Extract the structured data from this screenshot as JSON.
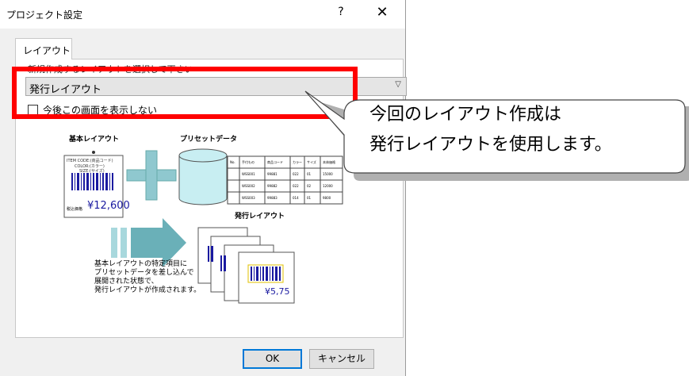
{
  "window": {
    "title": "プロジェクト設定",
    "help_glyph": "?",
    "close_glyph": "✕"
  },
  "tabs": [
    {
      "label": "レイアウト"
    }
  ],
  "form": {
    "instruction": "新規作成するレイアウトを選択して下さい",
    "layout_select": {
      "value": "発行レイアウト",
      "arrow_icon": "chevron-down-icon"
    },
    "dont_show_checkbox": {
      "label": "今後この画面を表示しない",
      "checked": false
    }
  },
  "illustration": {
    "base_layout_label": "基本レイアウト",
    "preset_data_label": "プリセットデータ",
    "issued_layout_label": "発行レイアウト",
    "tag": {
      "item_code": "ITEM CODE:(商品コード)",
      "color": "COLOR:(カラー)",
      "size": "SIZE:(サイズ)",
      "price_prefix": "税込価格",
      "price": "¥12,600"
    },
    "issued_tag_price": "¥5,75",
    "table": {
      "headers": [
        "No.",
        "手付もの",
        "商品コード",
        "カラー",
        "サイズ",
        "本体価格"
      ],
      "rows": [
        [
          "",
          "WSS001",
          "99881",
          "022",
          "01",
          "15000"
        ],
        [
          "",
          "WSS002",
          "99882",
          "022",
          "02",
          "12000"
        ],
        [
          "",
          "WSS003",
          "99883",
          "014",
          "01",
          "9800"
        ]
      ]
    },
    "description": [
      "基本レイアウトの特定項目に",
      "プリセットデータを差し込んで",
      "展開された状態で、",
      "発行レイアウトが作成されます。"
    ]
  },
  "buttons": {
    "ok": "OK",
    "cancel": "キャンセル"
  },
  "callout": {
    "line1": "今回のレイアウト作成は",
    "line2": "発行レイアウトを使用します。"
  },
  "colors": {
    "highlight": "#ff0000",
    "accent": "#0078d7",
    "arrow": "#5aa0a8"
  }
}
